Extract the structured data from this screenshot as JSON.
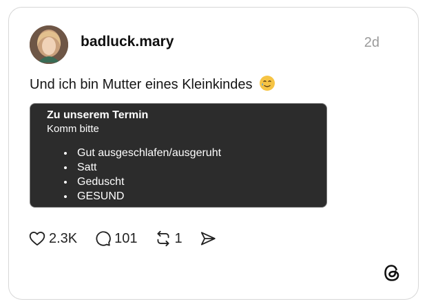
{
  "post": {
    "username": "badluck.mary",
    "time": "2d",
    "text": "Und ich bin Mutter eines Kleinkindes",
    "emoji": "smiling-face-with-tear-icon"
  },
  "quote": {
    "title": "Zu unserem Termin",
    "subtitle": "Komm bitte",
    "items": [
      "Gut ausgeschlafen/ausgeruht",
      "Satt",
      "Geduscht",
      "GESUND"
    ]
  },
  "actions": {
    "likes": "2.3K",
    "replies": "101",
    "reposts": "1"
  },
  "icons": {
    "like": "heart-icon",
    "reply": "speech-bubble-icon",
    "repost": "repost-icon",
    "share": "send-icon",
    "brand": "threads-logo-icon"
  }
}
